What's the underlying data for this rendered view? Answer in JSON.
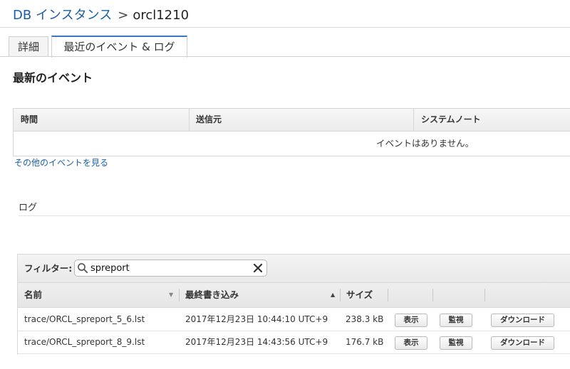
{
  "breadcrumb": {
    "link": "DB インスタンス",
    "separator": ">",
    "current": "orcl1210"
  },
  "tabs": [
    {
      "label": "詳細",
      "active": false
    },
    {
      "label": "最近のイベント & ログ",
      "active": true
    }
  ],
  "events": {
    "title": "最新のイベント",
    "columns": [
      "時間",
      "送信元",
      "システムノート"
    ],
    "empty_message": "イベントはありません。",
    "more_link": "その他のイベントを見る"
  },
  "logs": {
    "title": "ログ",
    "filter_label": "フィルター:",
    "filter_value": "spreport",
    "columns": [
      "名前",
      "最終書き込み",
      "サイズ"
    ],
    "rows": [
      {
        "name": "trace/ORCL_spreport_5_6.lst",
        "last_written": "2017年12月23日 10:44:10 UTC+9",
        "size": "238.3 kB"
      },
      {
        "name": "trace/ORCL_spreport_8_9.lst",
        "last_written": "2017年12月23日 14:43:56 UTC+9",
        "size": "176.7 kB"
      }
    ],
    "actions": {
      "view": "表示",
      "watch": "監視",
      "download": "ダウンロード"
    }
  },
  "colors": {
    "link": "#1a5fa8",
    "active_tab_accent": "#3b78c2"
  },
  "icons": {
    "search": "search-icon",
    "clear": "close-icon"
  }
}
